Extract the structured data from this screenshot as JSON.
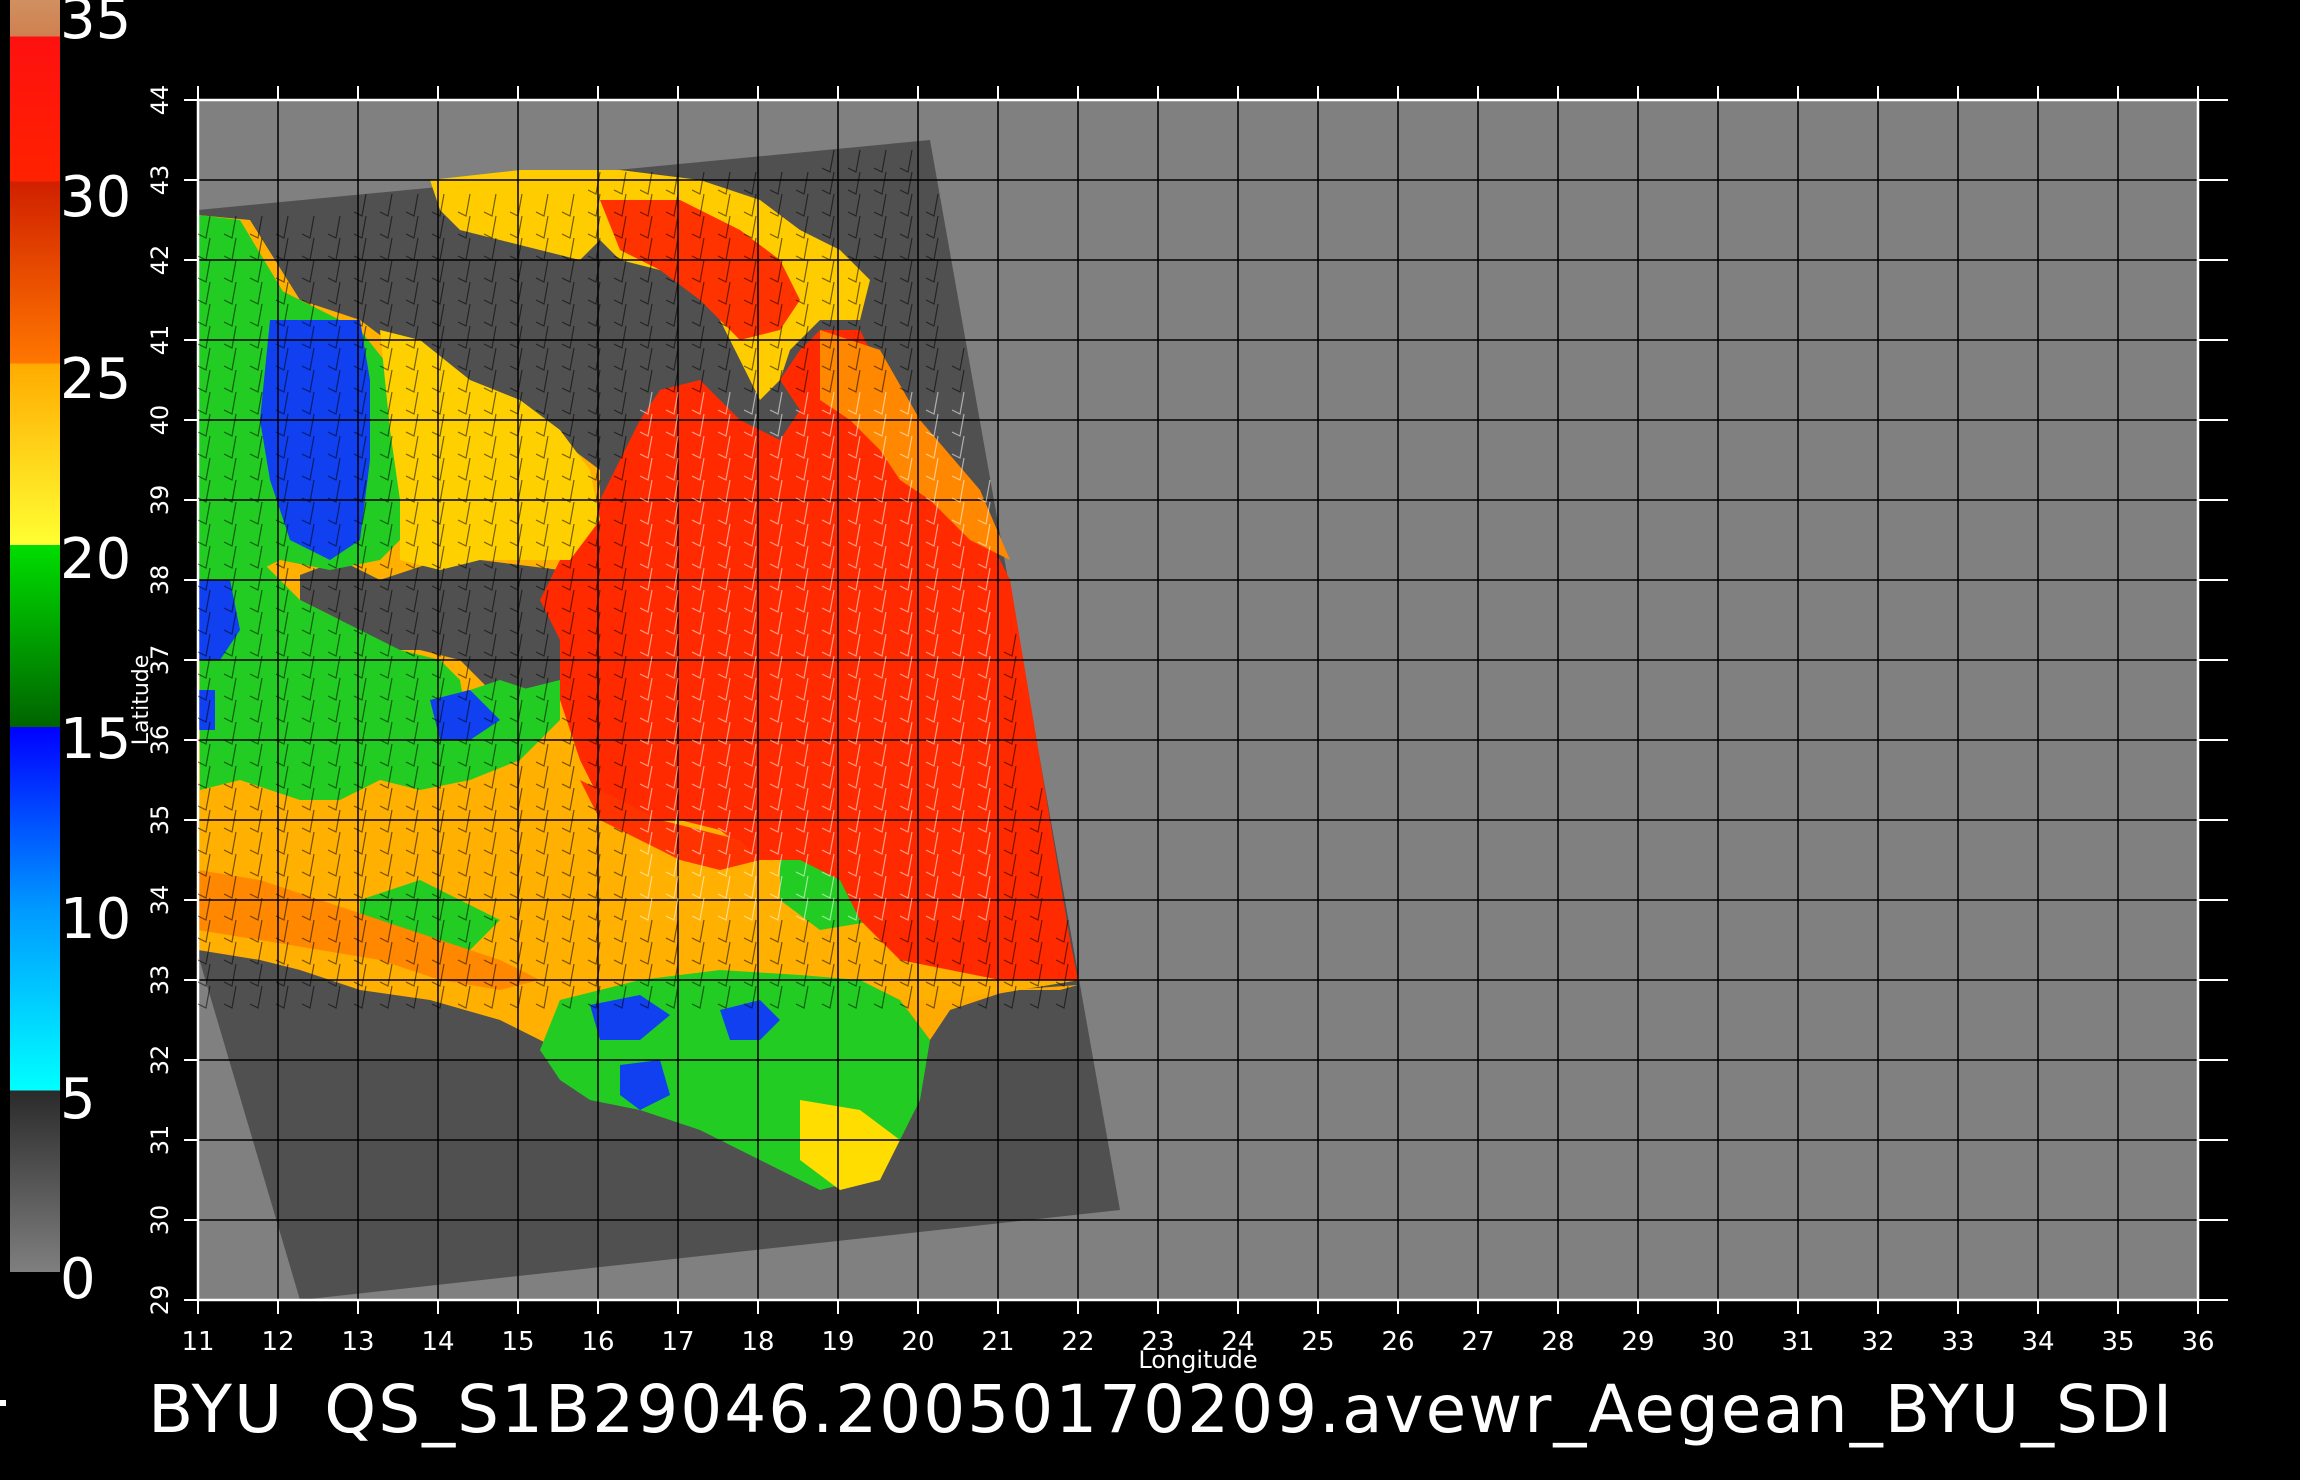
{
  "map": {
    "xlabel": "Longitude",
    "ylabel": "Latitude",
    "lon_range": [
      11,
      36
    ],
    "lat_range": [
      29,
      44
    ],
    "lon_ticks": [
      "11",
      "12",
      "13",
      "14",
      "15",
      "16",
      "17",
      "18",
      "19",
      "20",
      "21",
      "22",
      "23",
      "24",
      "25",
      "26",
      "27",
      "28",
      "29",
      "30",
      "31",
      "32",
      "33",
      "34",
      "35",
      "36"
    ],
    "lat_ticks": [
      "29",
      "30",
      "31",
      "32",
      "33",
      "34",
      "35",
      "36",
      "37",
      "38",
      "39",
      "40",
      "41",
      "42",
      "43",
      "44"
    ],
    "grid": true,
    "colors": {
      "background": "#000000",
      "plot_area": "#808080",
      "swath": "#505050",
      "grid": "#000000",
      "axes": "#ffffff"
    }
  },
  "colorbar": {
    "labels": [
      "35",
      "30",
      "25",
      "20",
      "15",
      "10",
      "5",
      "0"
    ],
    "range": [
      0,
      35
    ],
    "stops": [
      {
        "value": 0,
        "color": "#7f7f7f"
      },
      {
        "value": 5,
        "color": "#2a2a2a"
      },
      {
        "value": 5,
        "color": "#00ffff"
      },
      {
        "value": 10,
        "color": "#0099ff"
      },
      {
        "value": 15,
        "color": "#0000ff"
      },
      {
        "value": 15,
        "color": "#006400"
      },
      {
        "value": 20,
        "color": "#00dd00"
      },
      {
        "value": 20,
        "color": "#ffff33"
      },
      {
        "value": 25,
        "color": "#ffaa00"
      },
      {
        "value": 25,
        "color": "#ff7700"
      },
      {
        "value": 30,
        "color": "#d02000"
      },
      {
        "value": 30,
        "color": "#ff2200"
      },
      {
        "value": 34,
        "color": "#ff1010"
      },
      {
        "value": 34,
        "color": "#d08050"
      },
      {
        "value": 35,
        "color": "#d09060"
      }
    ]
  },
  "footer": {
    "left": "BYU",
    "right": "QS_S1B29046.20050170209.avewr_Aegean_BYU_SDI"
  }
}
